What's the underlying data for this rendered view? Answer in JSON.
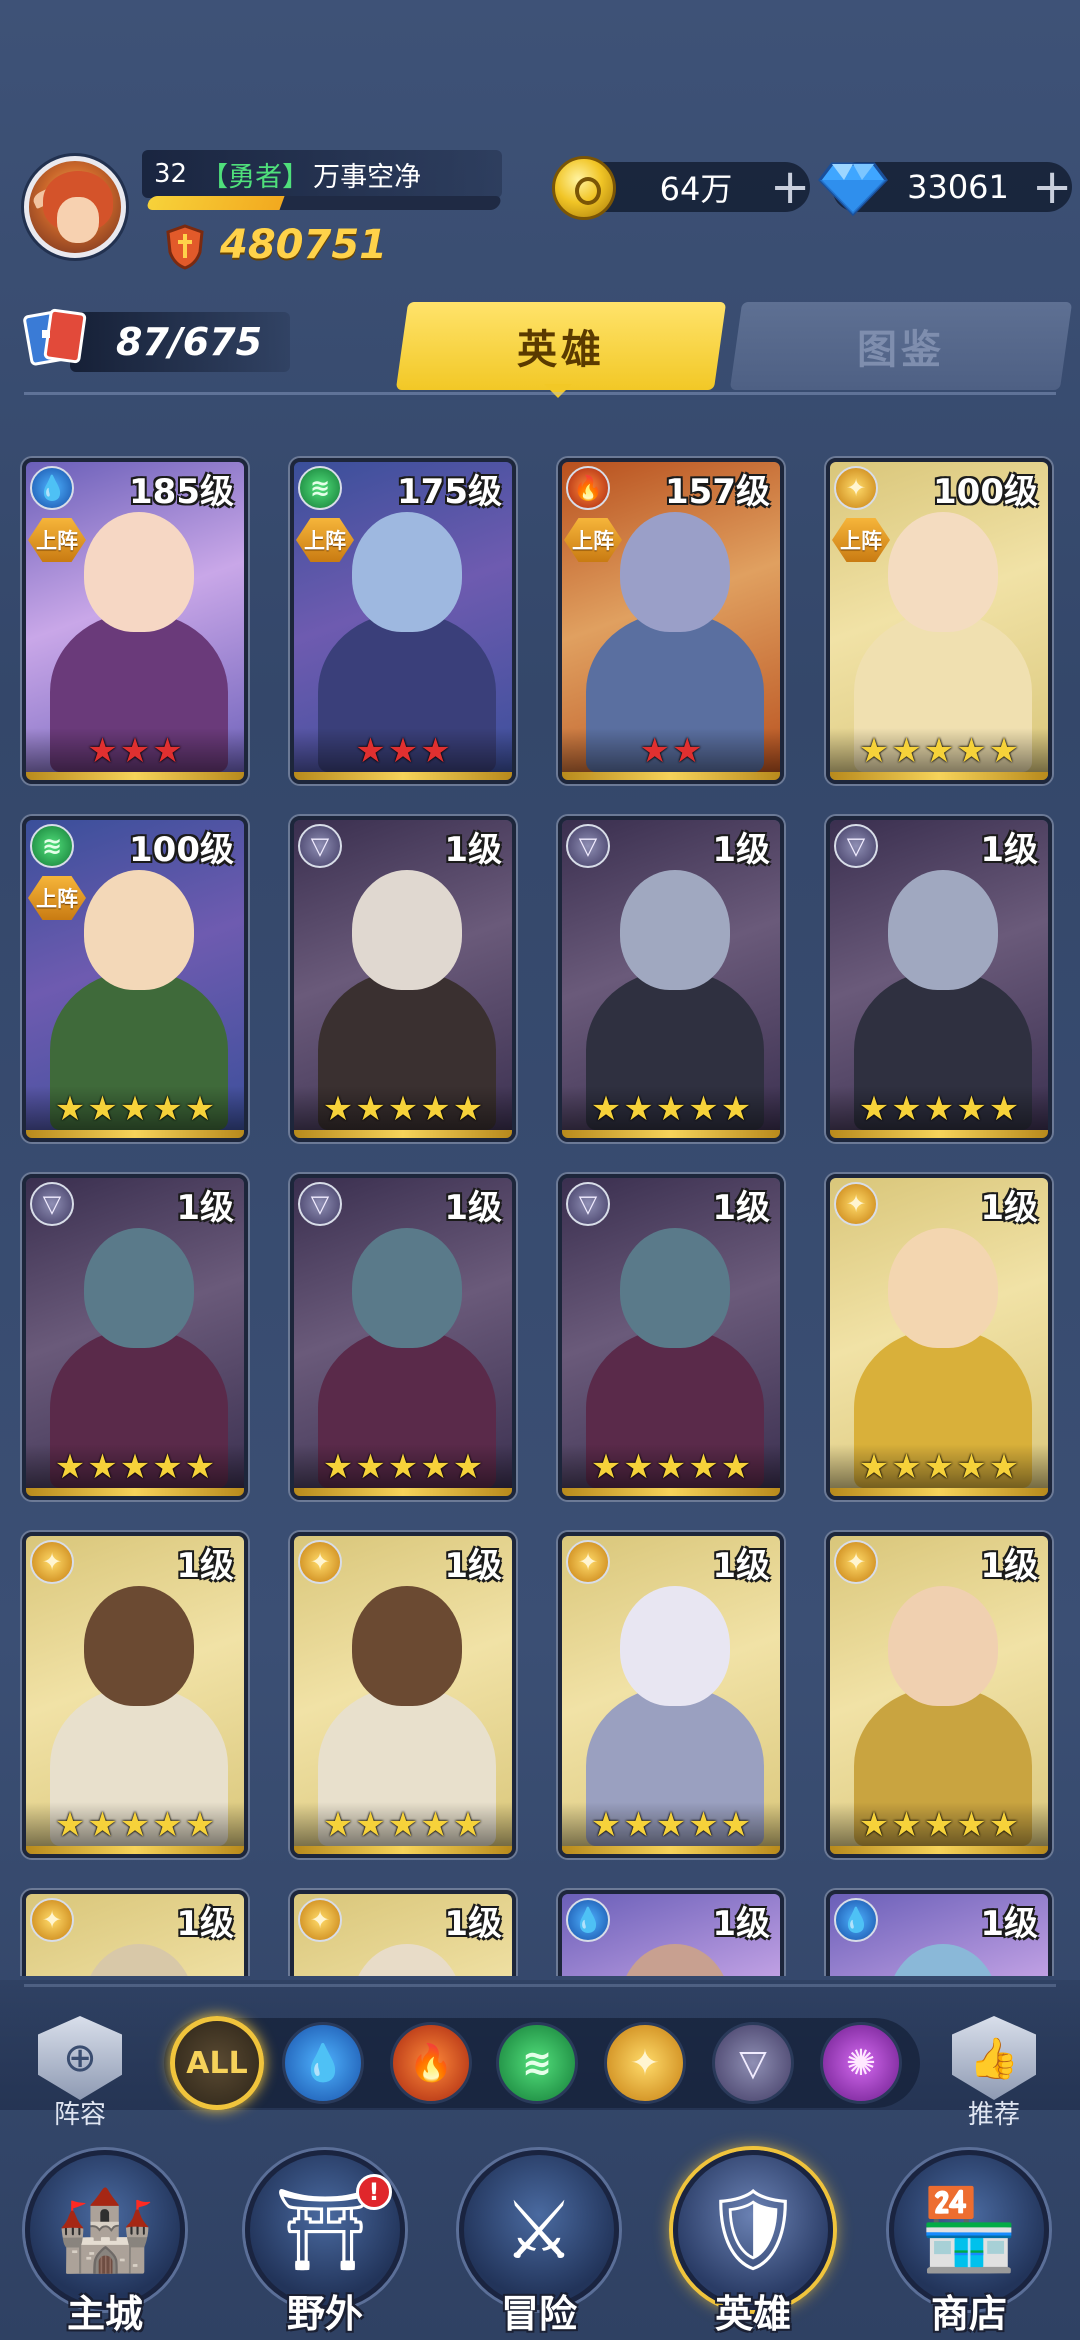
{
  "player": {
    "level": "32",
    "title": "【勇者】",
    "name": "万事空净",
    "exp_progress": 0.38,
    "power": "480751"
  },
  "resources": {
    "coins": "64万",
    "gems": "33061",
    "plus": "+"
  },
  "hero_count": "87/675",
  "tabs": {
    "heroes": "英雄",
    "codex": "图鉴"
  },
  "deployed_label": "上阵",
  "heroes": [
    {
      "level": "185级",
      "faction": "water",
      "stars": 3,
      "star_color": "#e03030",
      "deployed": true
    },
    {
      "level": "175级",
      "faction": "wind",
      "stars": 3,
      "star_color": "#e03030",
      "deployed": true
    },
    {
      "level": "157级",
      "faction": "fire",
      "stars": 2,
      "star_color": "#e03030",
      "deployed": true
    },
    {
      "level": "100级",
      "faction": "light",
      "stars": 5,
      "star_color": "#f6d23a",
      "deployed": true
    },
    {
      "level": "100级",
      "faction": "wind",
      "stars": 5,
      "star_color": "#f6d23a",
      "deployed": true
    },
    {
      "level": "1级",
      "faction": "dark",
      "stars": 5,
      "star_color": "#f6d23a",
      "deployed": false
    },
    {
      "level": "1级",
      "faction": "dark",
      "stars": 5,
      "star_color": "#f6d23a",
      "deployed": false
    },
    {
      "level": "1级",
      "faction": "dark",
      "stars": 5,
      "star_color": "#f6d23a",
      "deployed": false
    },
    {
      "level": "1级",
      "faction": "dark",
      "stars": 5,
      "star_color": "#f6d23a",
      "deployed": false
    },
    {
      "level": "1级",
      "faction": "dark",
      "stars": 5,
      "star_color": "#f6d23a",
      "deployed": false
    },
    {
      "level": "1级",
      "faction": "dark",
      "stars": 5,
      "star_color": "#f6d23a",
      "deployed": false
    },
    {
      "level": "1级",
      "faction": "light",
      "stars": 5,
      "star_color": "#f6d23a",
      "deployed": false
    },
    {
      "level": "1级",
      "faction": "light",
      "stars": 5,
      "star_color": "#f6d23a",
      "deployed": false
    },
    {
      "level": "1级",
      "faction": "light",
      "stars": 5,
      "star_color": "#f6d23a",
      "deployed": false
    },
    {
      "level": "1级",
      "faction": "light",
      "stars": 5,
      "star_color": "#f6d23a",
      "deployed": false
    },
    {
      "level": "1级",
      "faction": "light",
      "stars": 5,
      "star_color": "#f6d23a",
      "deployed": false
    },
    {
      "level": "1级",
      "faction": "light",
      "stars": 0,
      "star_color": "#f6d23a",
      "deployed": false
    },
    {
      "level": "1级",
      "faction": "light",
      "stars": 0,
      "star_color": "#f6d23a",
      "deployed": false
    },
    {
      "level": "1级",
      "faction": "water",
      "stars": 0,
      "star_color": "#f6d23a",
      "deployed": false
    },
    {
      "level": "1级",
      "faction": "water",
      "stars": 0,
      "star_color": "#f6d23a",
      "deployed": false
    }
  ],
  "filters": {
    "lineup_label": "阵容",
    "recommend_label": "推荐",
    "all_label": "ALL"
  },
  "nav": {
    "main_city": "主城",
    "wild": "野外",
    "adventure": "冒险",
    "heroes": "英雄",
    "shop": "商店",
    "badge": "!"
  },
  "colors": {
    "accent_gold": "#f2c826",
    "title_green": "#4fe07b",
    "power_gold": "#ffd24a"
  }
}
